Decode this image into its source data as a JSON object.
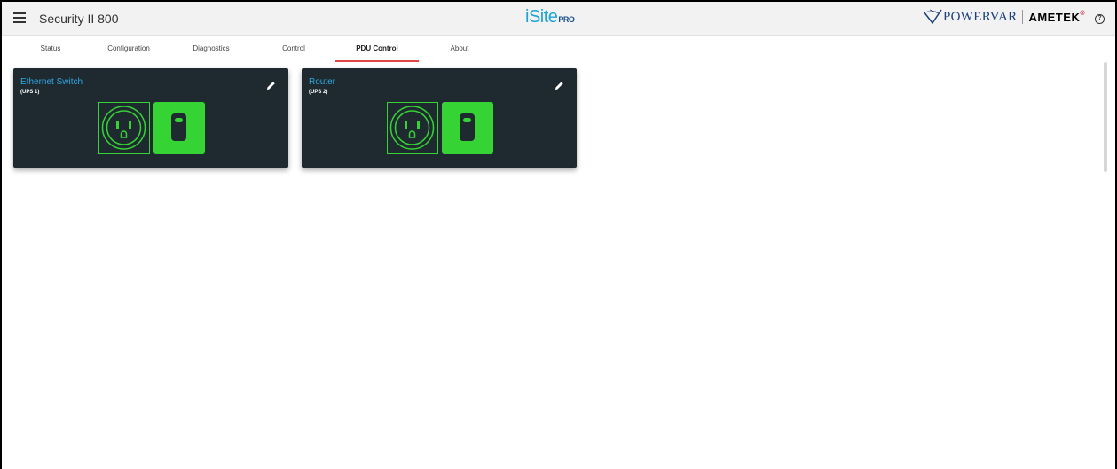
{
  "header": {
    "title": "Security II 800",
    "brand_main": "iSite",
    "brand_suffix": "PRO",
    "vendor_left": "POWERVAR",
    "vendor_right": "AMETEK"
  },
  "tabs": [
    {
      "label": "Status"
    },
    {
      "label": "Configuration"
    },
    {
      "label": "Diagnostics"
    },
    {
      "label": "Control"
    },
    {
      "label": "PDU Control",
      "active": true
    },
    {
      "label": "About"
    }
  ],
  "outlets": [
    {
      "name": "Ethernet Switch",
      "ups": "(UPS 1)",
      "state": "on"
    },
    {
      "name": "Router",
      "ups": "(UPS 2)",
      "state": "on"
    }
  ],
  "colors": {
    "accent_blue": "#2fa8e0",
    "outlet_green": "#35d434",
    "card_bg": "#1f2a30",
    "tab_active_underline": "#e04646"
  },
  "icons": {
    "menu": "hamburger-icon",
    "edit": "pencil-icon",
    "help": "help-circle-icon",
    "outlet": "power-outlet-icon",
    "switch": "rocker-switch-icon"
  }
}
